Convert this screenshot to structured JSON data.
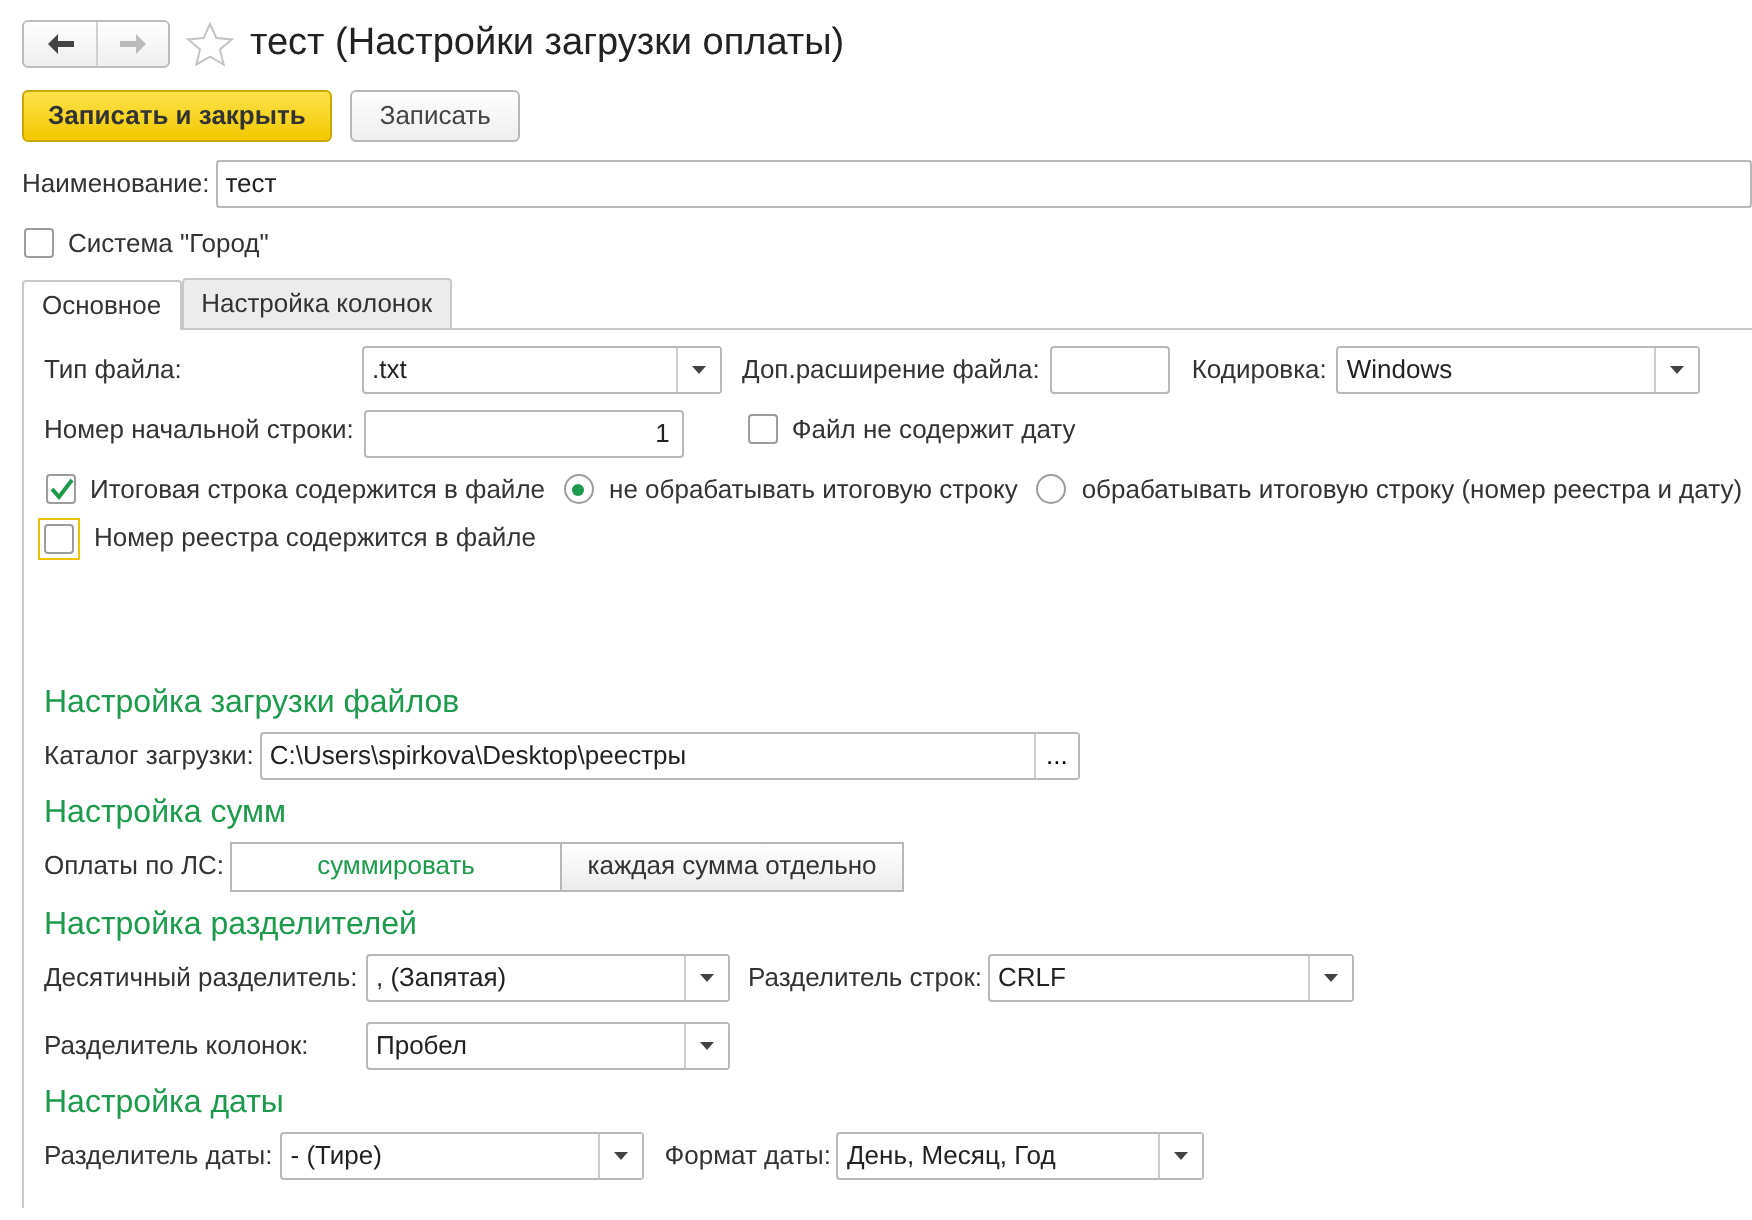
{
  "window": {
    "title": "тест (Настройки загрузки оплаты)",
    "favorite": false
  },
  "buttons": [
    {
      "label": "Записать и закрыть",
      "kind": "primary"
    },
    {
      "label": "Записать",
      "kind": "default"
    }
  ],
  "name_field": {
    "label": "Наименование:",
    "value": "тест"
  },
  "system_gorod": {
    "label": "Система \"Город\"",
    "checked": false
  },
  "tabs": [
    {
      "label": "Основное",
      "selected": true
    },
    {
      "label": "Настройка колонок",
      "selected": false
    }
  ],
  "file_type": {
    "label": "Тип файла:",
    "value": ".txt"
  },
  "extra_extension": {
    "label": "Доп.расширение файла:"
  },
  "encoding": {
    "label": "Кодировка:",
    "value": "Windows"
  },
  "start_row": {
    "label": "Номер начальной строки:",
    "value": "1"
  },
  "no_date": {
    "label": "Файл не содержит дату",
    "checked": false
  },
  "total_line": {
    "label": "Итоговая строка содержится в файле",
    "checked": true
  },
  "total_line_mode": [
    {
      "label": "не обрабатывать итоговую строку",
      "selected": true
    },
    {
      "label": "обрабатывать итоговую строку (номер реестра  и дату)",
      "selected": false
    }
  ],
  "registry_number": {
    "label": "Номер реестра содержится в файле",
    "checked": false,
    "focused": true
  },
  "files_section": {
    "title": "Настройка загрузки файлов",
    "label": "Каталог загрузки:",
    "value": "C:\\Users\\spirkova\\Desktop\\реестры",
    "button": "..."
  },
  "sums_section": {
    "title": "Настройка сумм",
    "label": "Оплаты по ЛС:",
    "options": [
      {
        "label": "суммировать",
        "selected": true
      },
      {
        "label": "каждая сумма отдельно",
        "selected": false
      }
    ]
  },
  "separators_section": {
    "title": "Настройка разделителей",
    "decimal": {
      "label": "Десятичный разделитель:",
      "value": ", (Запятая)"
    },
    "line": {
      "label": "Разделитель строк:",
      "value": "CRLF"
    },
    "column": {
      "label": "Разделитель колонок:",
      "value": "Пробел"
    }
  },
  "date_section": {
    "title": "Настройка даты",
    "separator": {
      "label": "Разделитель даты:",
      "value": "- (Тире)"
    },
    "format": {
      "label": "Формат даты:",
      "value": "День, Месяц, Год"
    }
  }
}
